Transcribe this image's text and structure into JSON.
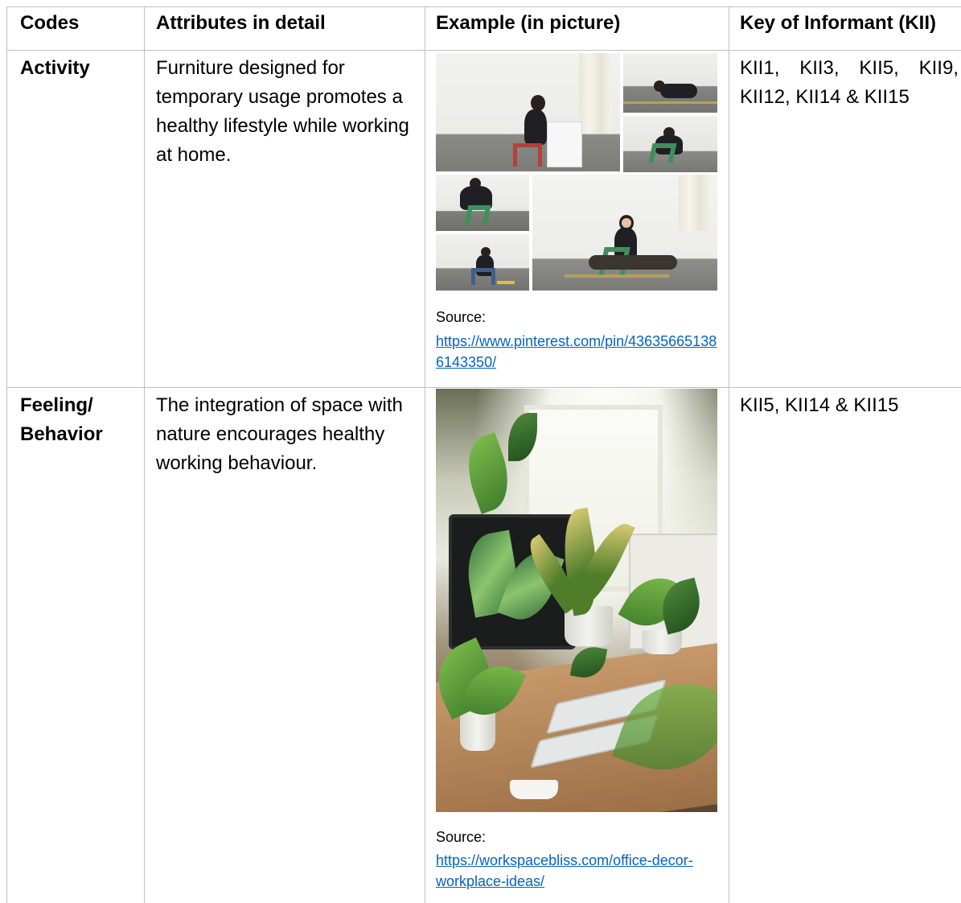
{
  "table": {
    "headers": [
      "Codes",
      "Attributes in detail",
      "Example (in picture)",
      "Key of Informant (KII)"
    ],
    "rows": [
      {
        "code": "Activity",
        "attributes": "Furniture designed for temporary usage promotes a healthy lifestyle while working at home.",
        "source_label": "Source:",
        "source_url": "https://www.pinterest.com/pin/436356651386143350/",
        "kii": "KII1, KII3, KII5, KII9, KII12, KII14 & KII15"
      },
      {
        "code": "Feeling/ Behavior",
        "attributes": "The integration of space with nature encourages healthy working behaviour.",
        "source_label": "Source:",
        "source_url": "https://workspacebliss.com/office-decor-workplace-ideas/",
        "kii": "KII5, KII14 & KII15"
      }
    ]
  }
}
